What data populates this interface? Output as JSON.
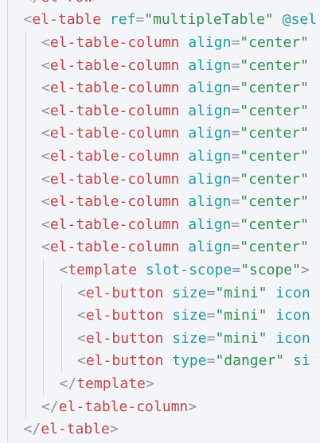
{
  "editor": {
    "lines": [
      {
        "indent": 1,
        "tokens": [
          {
            "t": "punct",
            "v": "</"
          },
          {
            "t": "tag",
            "v": "el-row"
          },
          {
            "t": "punct",
            "v": ">"
          }
        ]
      },
      {
        "indent": 1,
        "tokens": [
          {
            "t": "punct",
            "v": "<"
          },
          {
            "t": "tag",
            "v": "el-table"
          },
          {
            "t": "punct",
            "v": " "
          },
          {
            "t": "attr",
            "v": "ref"
          },
          {
            "t": "op",
            "v": "="
          },
          {
            "t": "str",
            "v": "\"multipleTable\""
          },
          {
            "t": "punct",
            "v": " "
          },
          {
            "t": "attr",
            "v": "@sel"
          }
        ]
      },
      {
        "indent": 2,
        "tokens": [
          {
            "t": "punct",
            "v": "<"
          },
          {
            "t": "tag",
            "v": "el-table-column"
          },
          {
            "t": "punct",
            "v": " "
          },
          {
            "t": "attr",
            "v": "align"
          },
          {
            "t": "op",
            "v": "="
          },
          {
            "t": "str",
            "v": "\"center\""
          }
        ]
      },
      {
        "indent": 2,
        "tokens": [
          {
            "t": "punct",
            "v": "<"
          },
          {
            "t": "tag",
            "v": "el-table-column"
          },
          {
            "t": "punct",
            "v": " "
          },
          {
            "t": "attr",
            "v": "align"
          },
          {
            "t": "op",
            "v": "="
          },
          {
            "t": "str",
            "v": "\"center\""
          }
        ]
      },
      {
        "indent": 2,
        "tokens": [
          {
            "t": "punct",
            "v": "<"
          },
          {
            "t": "tag",
            "v": "el-table-column"
          },
          {
            "t": "punct",
            "v": " "
          },
          {
            "t": "attr",
            "v": "align"
          },
          {
            "t": "op",
            "v": "="
          },
          {
            "t": "str",
            "v": "\"center\""
          }
        ]
      },
      {
        "indent": 2,
        "tokens": [
          {
            "t": "punct",
            "v": "<"
          },
          {
            "t": "tag",
            "v": "el-table-column"
          },
          {
            "t": "punct",
            "v": " "
          },
          {
            "t": "attr",
            "v": "align"
          },
          {
            "t": "op",
            "v": "="
          },
          {
            "t": "str",
            "v": "\"center\""
          }
        ]
      },
      {
        "indent": 2,
        "tokens": [
          {
            "t": "punct",
            "v": "<"
          },
          {
            "t": "tag",
            "v": "el-table-column"
          },
          {
            "t": "punct",
            "v": " "
          },
          {
            "t": "attr",
            "v": "align"
          },
          {
            "t": "op",
            "v": "="
          },
          {
            "t": "str",
            "v": "\"center\""
          }
        ]
      },
      {
        "indent": 2,
        "tokens": [
          {
            "t": "punct",
            "v": "<"
          },
          {
            "t": "tag",
            "v": "el-table-column"
          },
          {
            "t": "punct",
            "v": " "
          },
          {
            "t": "attr",
            "v": "align"
          },
          {
            "t": "op",
            "v": "="
          },
          {
            "t": "str",
            "v": "\"center\""
          }
        ]
      },
      {
        "indent": 2,
        "tokens": [
          {
            "t": "punct",
            "v": "<"
          },
          {
            "t": "tag",
            "v": "el-table-column"
          },
          {
            "t": "punct",
            "v": " "
          },
          {
            "t": "attr",
            "v": "align"
          },
          {
            "t": "op",
            "v": "="
          },
          {
            "t": "str",
            "v": "\"center\""
          }
        ]
      },
      {
        "indent": 2,
        "tokens": [
          {
            "t": "punct",
            "v": "<"
          },
          {
            "t": "tag",
            "v": "el-table-column"
          },
          {
            "t": "punct",
            "v": " "
          },
          {
            "t": "attr",
            "v": "align"
          },
          {
            "t": "op",
            "v": "="
          },
          {
            "t": "str",
            "v": "\"center\""
          }
        ]
      },
      {
        "indent": 2,
        "tokens": [
          {
            "t": "punct",
            "v": "<"
          },
          {
            "t": "tag",
            "v": "el-table-column"
          },
          {
            "t": "punct",
            "v": " "
          },
          {
            "t": "attr",
            "v": "align"
          },
          {
            "t": "op",
            "v": "="
          },
          {
            "t": "str",
            "v": "\"center\""
          }
        ]
      },
      {
        "indent": 2,
        "tokens": [
          {
            "t": "punct",
            "v": "<"
          },
          {
            "t": "tag",
            "v": "el-table-column"
          },
          {
            "t": "punct",
            "v": " "
          },
          {
            "t": "attr",
            "v": "align"
          },
          {
            "t": "op",
            "v": "="
          },
          {
            "t": "str",
            "v": "\"center\""
          }
        ]
      },
      {
        "indent": 3,
        "tokens": [
          {
            "t": "punct",
            "v": "<"
          },
          {
            "t": "tag",
            "v": "template"
          },
          {
            "t": "punct",
            "v": " "
          },
          {
            "t": "attr",
            "v": "slot-scope"
          },
          {
            "t": "op",
            "v": "="
          },
          {
            "t": "str",
            "v": "\"scope\""
          },
          {
            "t": "punct",
            "v": ">"
          }
        ]
      },
      {
        "indent": 4,
        "tokens": [
          {
            "t": "punct",
            "v": "<"
          },
          {
            "t": "tag",
            "v": "el-button"
          },
          {
            "t": "punct",
            "v": " "
          },
          {
            "t": "attr",
            "v": "size"
          },
          {
            "t": "op",
            "v": "="
          },
          {
            "t": "str",
            "v": "\"mini\""
          },
          {
            "t": "punct",
            "v": " "
          },
          {
            "t": "attr",
            "v": "icon"
          }
        ]
      },
      {
        "indent": 4,
        "tokens": [
          {
            "t": "punct",
            "v": "<"
          },
          {
            "t": "tag",
            "v": "el-button"
          },
          {
            "t": "punct",
            "v": " "
          },
          {
            "t": "attr",
            "v": "size"
          },
          {
            "t": "op",
            "v": "="
          },
          {
            "t": "str",
            "v": "\"mini\""
          },
          {
            "t": "punct",
            "v": " "
          },
          {
            "t": "attr",
            "v": "icon"
          }
        ]
      },
      {
        "indent": 4,
        "tokens": [
          {
            "t": "punct",
            "v": "<"
          },
          {
            "t": "tag",
            "v": "el-button"
          },
          {
            "t": "punct",
            "v": " "
          },
          {
            "t": "attr",
            "v": "size"
          },
          {
            "t": "op",
            "v": "="
          },
          {
            "t": "str",
            "v": "\"mini\""
          },
          {
            "t": "punct",
            "v": " "
          },
          {
            "t": "attr",
            "v": "icon"
          }
        ]
      },
      {
        "indent": 4,
        "tokens": [
          {
            "t": "punct",
            "v": "<"
          },
          {
            "t": "tag",
            "v": "el-button"
          },
          {
            "t": "punct",
            "v": " "
          },
          {
            "t": "attr",
            "v": "type"
          },
          {
            "t": "op",
            "v": "="
          },
          {
            "t": "str",
            "v": "\"danger\""
          },
          {
            "t": "punct",
            "v": " "
          },
          {
            "t": "attr",
            "v": "si"
          }
        ]
      },
      {
        "indent": 3,
        "tokens": [
          {
            "t": "punct",
            "v": "</"
          },
          {
            "t": "tag",
            "v": "template"
          },
          {
            "t": "punct",
            "v": ">"
          }
        ]
      },
      {
        "indent": 2,
        "tokens": [
          {
            "t": "punct",
            "v": "</"
          },
          {
            "t": "tag",
            "v": "el-table-column"
          },
          {
            "t": "punct",
            "v": ">"
          }
        ]
      },
      {
        "indent": 1,
        "tokens": [
          {
            "t": "punct",
            "v": "</"
          },
          {
            "t": "tag",
            "v": "el-table"
          },
          {
            "t": "punct",
            "v": ">"
          }
        ]
      }
    ]
  },
  "theme": {
    "background": "#f4f5f9",
    "tag": "#c2454a",
    "attribute": "#1f9aa3",
    "string": "#2f8f4d",
    "punctuation": "#8e929c",
    "indent_guide": "#d3d6de"
  }
}
